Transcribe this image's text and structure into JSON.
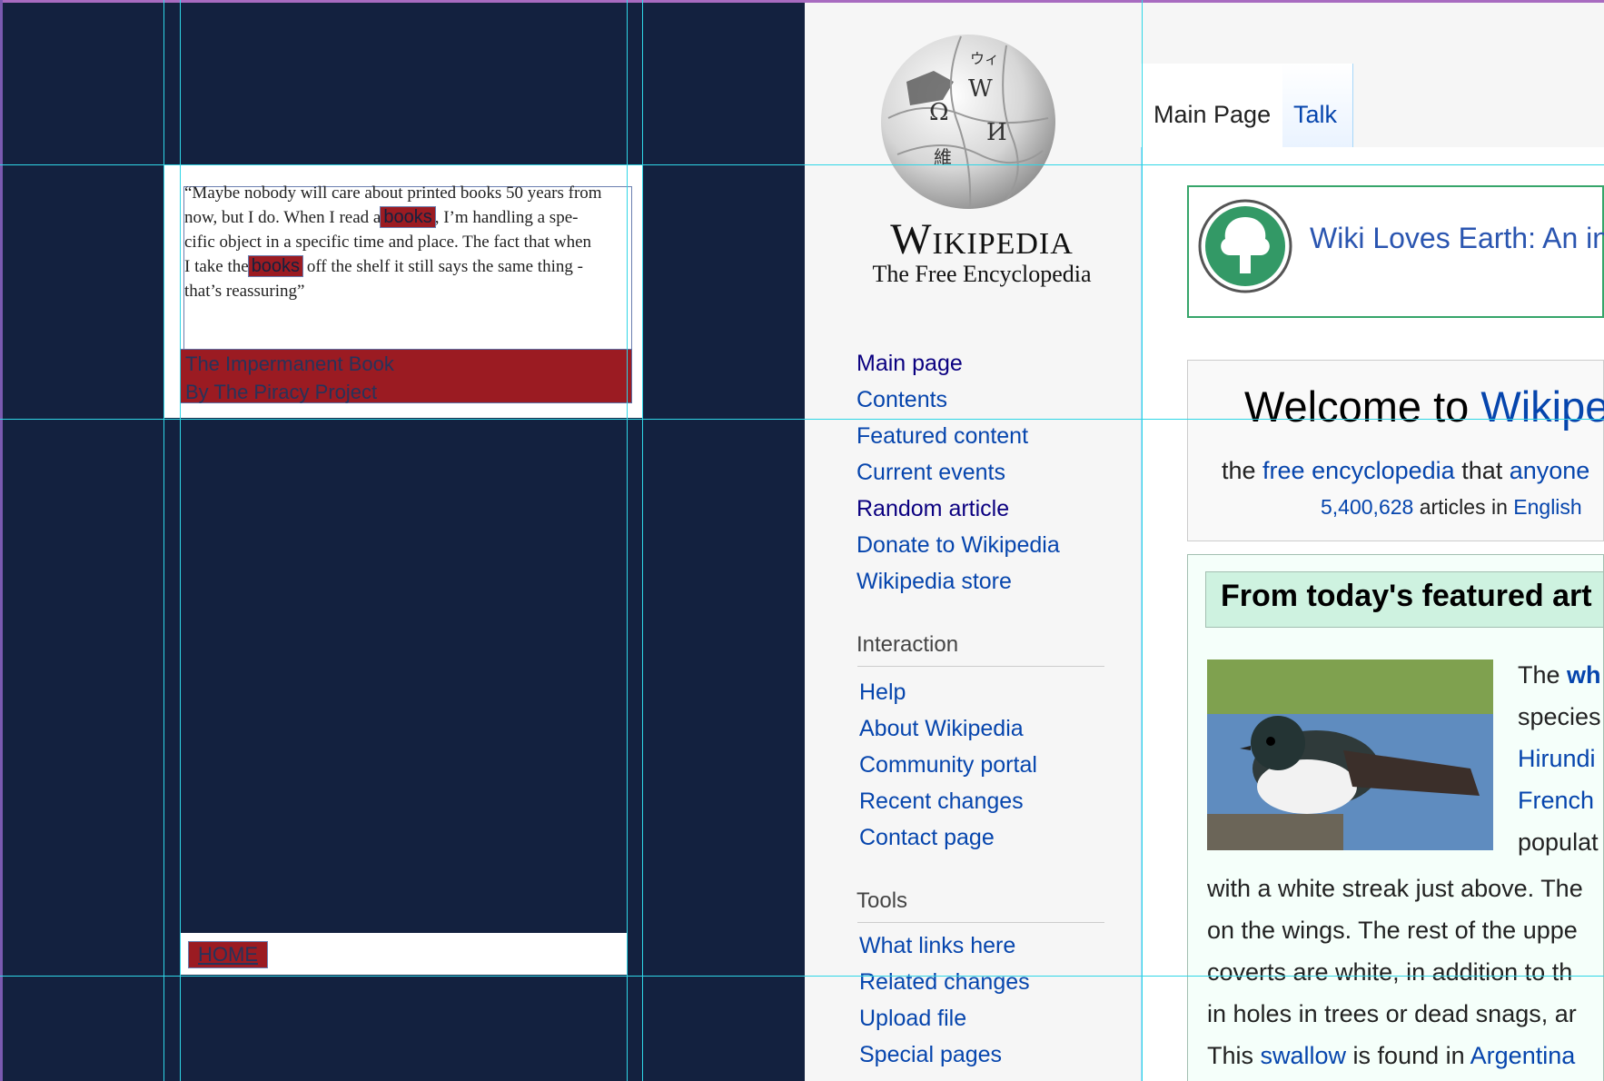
{
  "design": {
    "quote": {
      "line1": "“Maybe nobody will care about printed books 50 years from",
      "line2_pre": "now, but I do. When I read a",
      "hl1": "books",
      "line2_post": ", I’m handling a spe-",
      "line3": "cific object in a specific time and place. The fact that when",
      "line4_pre": "I take the",
      "hl2": "books",
      "line4_post": " off the shelf it still says the same thing -",
      "line5": "that’s reassuring”"
    },
    "credit": {
      "title": "The Impermanent Book",
      "by": "By The Piracy Project"
    },
    "home": "HOME"
  },
  "wiki": {
    "logo": {
      "title": "Wikipedia",
      "tagline": "The Free Encyclopedia"
    },
    "tabs": [
      "Main Page",
      "Talk"
    ],
    "nav_main": [
      "Main page",
      "Contents",
      "Featured content",
      "Current events",
      "Random article",
      "Donate to Wikipedia",
      "Wikipedia store"
    ],
    "interaction": {
      "heading": "Interaction",
      "items": [
        "Help",
        "About Wikipedia",
        "Community portal",
        "Recent changes",
        "Contact page"
      ]
    },
    "tools": {
      "heading": "Tools",
      "items": [
        "What links here",
        "Related changes",
        "Upload file",
        "Special pages"
      ]
    },
    "banner": "Wiki Loves Earth: An in",
    "welcome": {
      "title_pre": "Welcome to ",
      "title_link": "Wikipe",
      "sub_pre": "the ",
      "sub_link1": "free encyclopedia",
      "sub_mid": " that ",
      "sub_link2": "anyone",
      "count": "5,400,628",
      "count_mid": " articles in ",
      "count_link": "English"
    },
    "featured": {
      "heading": "From today's featured art",
      "side": [
        "The wh",
        "species",
        "Hirundi",
        "French",
        "populat"
      ],
      "para": [
        "with a white streak just above. The",
        "on the wings. The rest of the uppe",
        "coverts are white, in addition to th",
        "in holes in trees or dead snags, ar"
      ],
      "last_pre": "This ",
      "last_link1": "swallow",
      "last_mid": " is found in ",
      "last_link2": "Argentina"
    }
  }
}
